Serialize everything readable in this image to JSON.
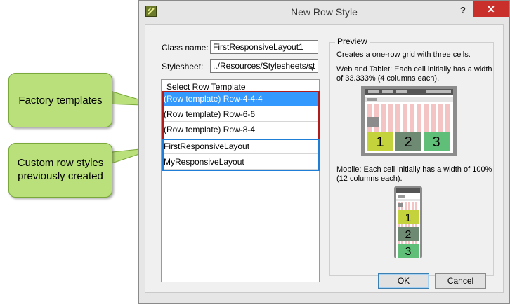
{
  "dialog": {
    "title": "New Row Style",
    "help": "?",
    "close": "✕"
  },
  "form": {
    "class_name_label": "Class name:",
    "class_name_value": "FirstResponsiveLayout1",
    "stylesheet_label": "Stylesheet:",
    "stylesheet_value": "../Resources/Stylesheets/st"
  },
  "template_list": {
    "header": "Select Row Template",
    "items": [
      {
        "label": "(Row template) Row-4-4-4",
        "selected": true
      },
      {
        "label": "(Row template) Row-6-6",
        "selected": false
      },
      {
        "label": "(Row template) Row-8-4",
        "selected": false
      },
      {
        "label": "FirstResponsiveLayout",
        "selected": false
      },
      {
        "label": "MyResponsiveLayout",
        "selected": false
      }
    ]
  },
  "preview": {
    "legend": "Preview",
    "line1": "Creates a one-row grid with three cells.",
    "web_text": "Web and Tablet: Each cell initially has a width of 33.333% (4 columns each).",
    "mobile_text": "Mobile: Each cell initially has a width of 100% (12 columns each).",
    "cells": [
      "1",
      "2",
      "3"
    ],
    "cell_colors": [
      "#c4d23c",
      "#6f8a72",
      "#5fbf78"
    ],
    "stripe_color": "#f4c4c4"
  },
  "buttons": {
    "ok": "OK",
    "cancel": "Cancel"
  },
  "callouts": {
    "factory": "Factory templates",
    "custom": "Custom row styles previously created"
  }
}
